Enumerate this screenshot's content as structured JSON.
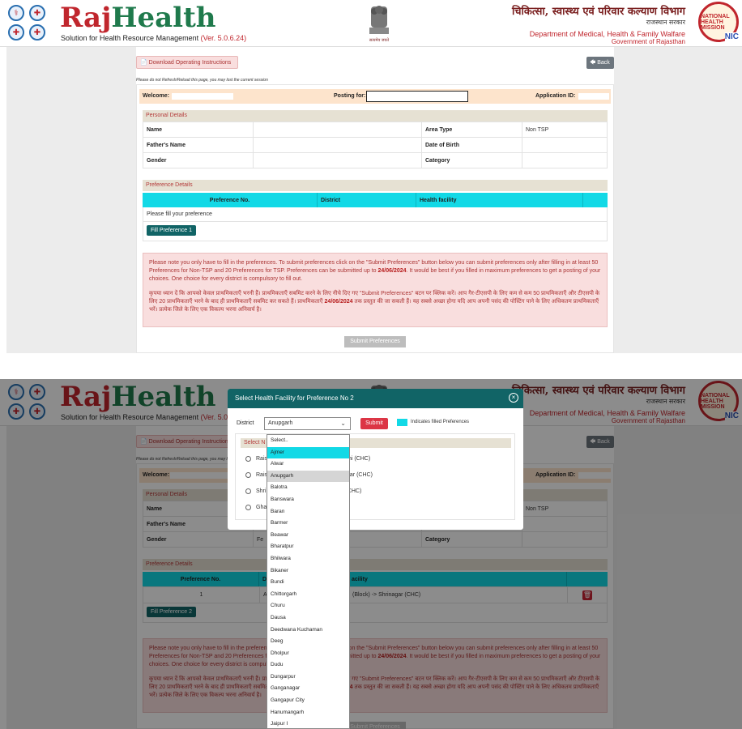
{
  "header": {
    "brand_raj": "Raj",
    "brand_health": "Health",
    "tagline": "Solution for Health Resource Management",
    "version": "(Ver. 5.0.6.24)",
    "hindi_dept": "चिकित्सा, स्वास्थ्य एवं परिवार कल्याण विभाग",
    "hindi_gov": "राजस्थान सरकार",
    "dept_en": "Department of Medical, Health & Family Walfare",
    "gov_en": "Government of Rajasthan",
    "emblem_caption": "सत्यमेव जयते",
    "nhm": "NATIONAL HEALTH MISSION",
    "nic": "NIC"
  },
  "actions": {
    "download": "Download Operating Instructions",
    "back": "Back",
    "warning": "Please do not Refresh/Reload this page, you may lost the current session"
  },
  "welcome": {
    "welcome_label": "Welcome:",
    "posting_label": "Posting for:",
    "application_label": "Application ID:"
  },
  "personal": {
    "title": "Personal Details",
    "name_label": "Name",
    "father_label": "Father's Name",
    "gender_label": "Gender",
    "area_label": "Area Type",
    "area_value": "Non TSP",
    "dob_label": "Date of Birth",
    "category_label": "Category",
    "gender_value_partial": "Fe"
  },
  "preference": {
    "title": "Preference Details",
    "col_no": "Preference No.",
    "col_district": "District",
    "col_facility": "Health facility",
    "col_facility_partial": "acility",
    "empty_text": "Please fill your preference",
    "fill_button_1": "Fill Preference 1",
    "fill_button_2": "Fill Preference 2",
    "row1_no": "1",
    "row1_district_partial": "A",
    "row1_facility_partial": "(Block) -> Shrinagar (CHC)"
  },
  "note": {
    "en_before": "Please note you only have to fill in the preferences. To submit preferences click on the \"Submit Preferences\" button below you can submit preferences only after filling in at least 50 Preferences for Non-TSP and 20 Preferences for TSP. Preferences can be submitted up to ",
    "en_date": "24/06/2024",
    "en_after": ". It would be best if you filled in maximum preferences to get a posting of your choices. One choice for every district is compulsory to fill out.",
    "hi_before": "कृपया ध्यान दें कि आपको केवल प्राथमिकताएँ भरनी हैं। प्राथमिकताएँ सबमिट करने के लिए नीचे दिए गए \"Submit Preferences\" बटन पर क्लिक करें। आप गैर-टीएसपी के लिए कम से कम 50 प्राथमिकताएँ और टीएसपी के लिए 20 प्राथमिकताएँ भरने के बाद ही प्राथमिकताएँ सबमिट कर सकते हैं। प्राथमिकताएँ ",
    "hi_date": "24/06/2024",
    "hi_after": " तक प्रस्तुत की जा सकती हैं। यह सबसे अच्छा होगा यदि आप अपनी पसंद की पोस्टिंग पाने के लिए अधिकतम प्राथमिकताएँ भरें। प्रत्येक जिले के लिए एक विकल्प भरना अनिवार्य है।",
    "submit_preferences": "Submit Preferences"
  },
  "modal": {
    "title": "Select Health Facility for Preference No   2",
    "district_label": "District",
    "district_value": "Anupgarh",
    "submit": "Submit",
    "legend": "Indicates filled Preferences",
    "select_title_partial": "Select N",
    "rows": [
      {
        "left": "Rais",
        "right": "thi (CHC)"
      },
      {
        "left": "Rais",
        "right": "gar (CHC)"
      },
      {
        "left": "Shri",
        "right": "(CHC)"
      },
      {
        "left": "Gha",
        "right": ")"
      }
    ],
    "options": [
      "Select..",
      "Ajmer",
      "Alwar",
      "Anupgarh",
      "Balotra",
      "Banswara",
      "Baran",
      "Barmer",
      "Beawar",
      "Bharatpur",
      "Bhilwara",
      "Bikaner",
      "Bundi",
      "Chittorgarh",
      "Churu",
      "Dausa",
      "Deedwana Kuchaman",
      "Deeg",
      "Dholpur",
      "Dudu",
      "Dungarpur",
      "Ganganagar",
      "Gangapur City",
      "Hanumangarh",
      "Jaipur I"
    ]
  },
  "colors": {
    "brand_red": "#c0262d",
    "brand_green": "#1f7a4c",
    "teal": "#116466",
    "cyan": "#12d9e6",
    "note_bg": "#f9dede"
  }
}
